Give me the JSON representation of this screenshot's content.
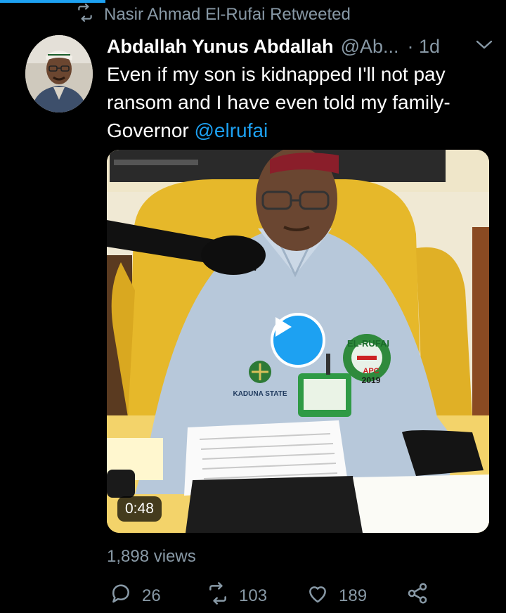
{
  "retweet": {
    "text": "Nasir Ahmad El-Rufai Retweeted"
  },
  "tweet": {
    "display_name": "Abdallah Yunus Abdallah",
    "handle": "@Ab...",
    "time": "· 1d",
    "text_line1": "Even if my son is kidnapped I'll not pay",
    "text_line2": "ransom and I have even told my family-",
    "text_line3_prefix": "Governor ",
    "mention": "@elrufai"
  },
  "media": {
    "duration": "0:48",
    "badge_text": "EL-RUFAI",
    "badge_party": "APC",
    "badge_year": "2019",
    "crest_text": "KADUNA STATE"
  },
  "stats": {
    "views": "1,898 views"
  },
  "actions": {
    "replies": "26",
    "retweets": "103",
    "likes": "189"
  },
  "icons": {
    "retweet": "retweet-icon",
    "reply": "reply-icon",
    "like": "heart-icon",
    "share": "share-icon",
    "menu": "chevron-down-icon",
    "play": "play-icon"
  },
  "colors": {
    "accent": "#1da1f2",
    "muted": "#8899a6",
    "background": "#000000"
  }
}
